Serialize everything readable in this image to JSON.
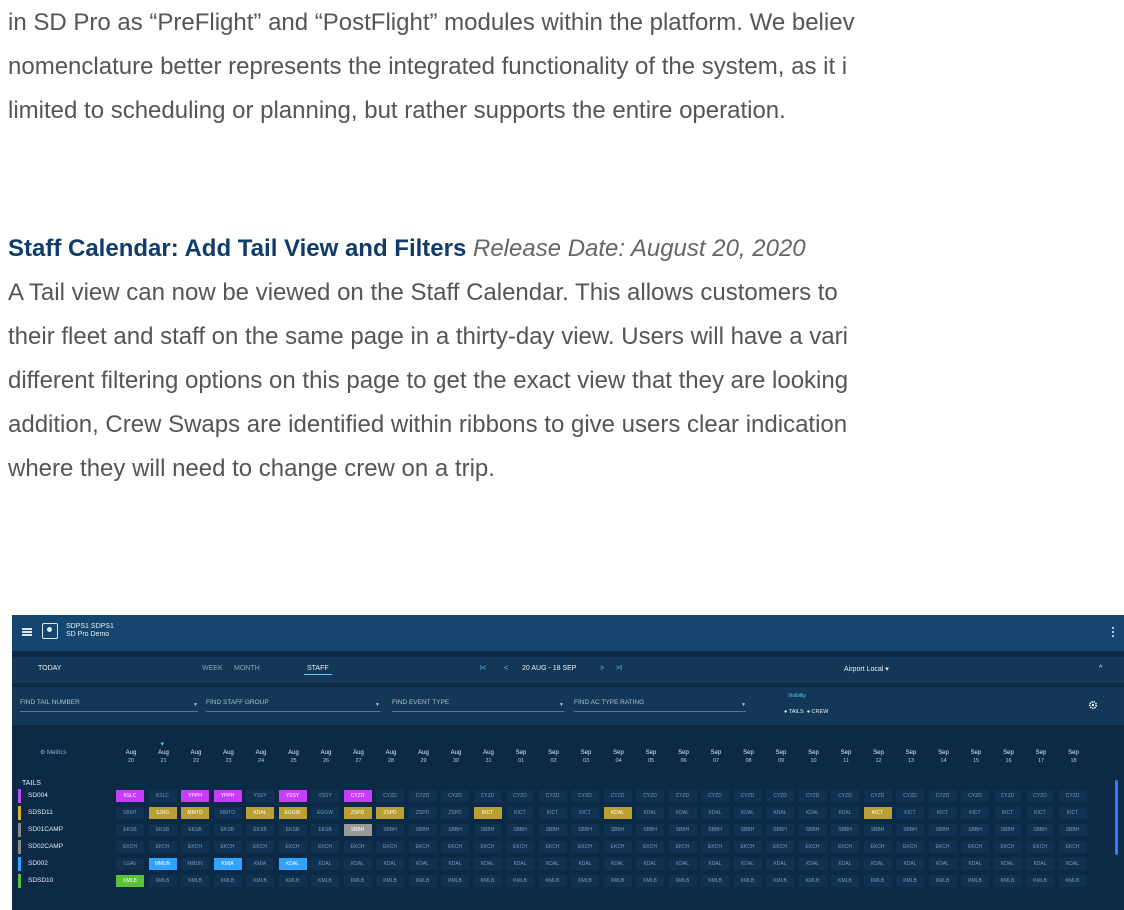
{
  "article": {
    "lines": [
      "in SD Pro as “PreFlight” and “PostFlight” modules within the platform. We believ",
      "nomenclature better represents the integrated functionality of the system, as it i",
      "limited to scheduling or planning, but rather supports the entire operation."
    ],
    "heading_title": "Staff Calendar: Add Tail View and Filters",
    "heading_date": "Release Date: August 20, 2020",
    "body": [
      "A Tail view can now be viewed on the Staff Calendar. This allows customers to",
      "their fleet and staff on the same page in a thirty-day view. Users will have a vari",
      "different filtering options on this page to get the exact view that they are looking",
      "addition, Crew Swaps are identified within ribbons to give users clear indication",
      "where they will need to change crew on a trip."
    ]
  },
  "app": {
    "user_line1": "SDPS1 SDPS1",
    "user_line2": "SD Pro Demo",
    "today": "TODAY",
    "week": "WEEK",
    "month": "MONTH",
    "staff": "STAFF",
    "first_icon": "first-page-icon",
    "prev_icon": "chevron-left-icon",
    "range": "20 AUG - 18 SEP",
    "next_icon": "chevron-right-icon",
    "last_icon": "last-page-icon",
    "airport": "Airport Local ▾",
    "filters": [
      "FIND TAIL NUMBER",
      "FIND STAFF GROUP",
      "FIND EVENT TYPE",
      "FIND AC TYPE RATING"
    ],
    "visibility": "Visibility",
    "vis_tails": "● TAILS",
    "vis_crew": "● CREW",
    "metrics": "Metrics",
    "tails_label": "TAILS",
    "dates": [
      [
        "Aug",
        "20"
      ],
      [
        "Aug",
        "21"
      ],
      [
        "Aug",
        "22"
      ],
      [
        "Aug",
        "23"
      ],
      [
        "Aug",
        "24"
      ],
      [
        "Aug",
        "25"
      ],
      [
        "Aug",
        "26"
      ],
      [
        "Aug",
        "27"
      ],
      [
        "Aug",
        "28"
      ],
      [
        "Aug",
        "29"
      ],
      [
        "Aug",
        "30"
      ],
      [
        "Aug",
        "31"
      ],
      [
        "Sep",
        "01"
      ],
      [
        "Sep",
        "02"
      ],
      [
        "Sep",
        "03"
      ],
      [
        "Sep",
        "04"
      ],
      [
        "Sep",
        "05"
      ],
      [
        "Sep",
        "06"
      ],
      [
        "Sep",
        "07"
      ],
      [
        "Sep",
        "08"
      ],
      [
        "Sep",
        "09"
      ],
      [
        "Sep",
        "10"
      ],
      [
        "Sep",
        "11"
      ],
      [
        "Sep",
        "12"
      ],
      [
        "Sep",
        "13"
      ],
      [
        "Sep",
        "14"
      ],
      [
        "Sep",
        "15"
      ],
      [
        "Sep",
        "16"
      ],
      [
        "Sep",
        "17"
      ],
      [
        "Sep",
        "18"
      ]
    ],
    "today_index": 1,
    "rows": [
      {
        "name": "SD004",
        "tag": "#b84cff",
        "cells": [
          "KSLC",
          "KSLC",
          "YPPH",
          "YPPH",
          "YSSY",
          "YSSY",
          "YSSY",
          "CYZD",
          "CYZD",
          "CYZD",
          "CYZD",
          "CYZD",
          "CYZD",
          "CYZD",
          "CYZD",
          "CYZD",
          "CYZD",
          "CYZD",
          "CYZD",
          "CYZD",
          "CYZD",
          "CYZD",
          "CYZD",
          "CYZD",
          "CYZD",
          "CYZD",
          "CYZD",
          "CYZD",
          "CYZD",
          "CYZD"
        ],
        "hl": {
          "0": "#c83cff",
          "2": "#c83cff",
          "3": "#c83cff",
          "5": "#c83cff",
          "7": "#c83cff"
        }
      },
      {
        "name": "SDSD11",
        "tag": "#d6b52e",
        "cells": [
          "SBMT",
          "SJRG",
          "MMTO",
          "MMTO",
          "KDAL",
          "EGGW",
          "EGGW",
          "ZSPD",
          "ZSPD",
          "ZSPD",
          "ZSPD",
          "KICT",
          "KICT",
          "KICT",
          "KICT",
          "KDAL",
          "KDAL",
          "KDAL",
          "KDAL",
          "KDAL",
          "KDAL",
          "KDAL",
          "KDAL",
          "KICT",
          "KICT",
          "KICT",
          "KICT",
          "KICT",
          "KICT",
          "KICT"
        ],
        "hl": {
          "1": "#b8a032",
          "2": "#b8a032",
          "4": "#b8a032",
          "5": "#b8a032",
          "7": "#b8a032",
          "8": "#b8a032",
          "11": "#b8a032",
          "15": "#b8a032",
          "23": "#b8a032"
        }
      },
      {
        "name": "SD01CAMP",
        "tag": "#8a8a8a",
        "cells": [
          "EKSB",
          "EKSB",
          "EKSB",
          "EKSB",
          "EKSB",
          "EKSB",
          "EKSB",
          "SBBH",
          "SBBH",
          "SBBH",
          "SBBH",
          "SBBH",
          "SBBH",
          "SBBH",
          "SBBH",
          "SBBH",
          "SBBH",
          "SBBH",
          "SBBH",
          "SBBH",
          "SBBH",
          "SBBH",
          "SBBH",
          "SBBH",
          "SBBH",
          "SBBH",
          "SBBH",
          "SBBH",
          "SBBH",
          "SBBH"
        ],
        "hl": {
          "7": "#9a9a9a"
        }
      },
      {
        "name": "SD02CAMP",
        "tag": "#8a8a8a",
        "cells": [
          "EKCH",
          "EKCH",
          "EKCH",
          "EKCH",
          "EKCH",
          "EKCH",
          "EKCH",
          "EKCH",
          "EKCH",
          "EKCH",
          "EKCH",
          "EKCH",
          "EKCH",
          "EKCH",
          "EKCH",
          "EKCH",
          "EKCH",
          "EKCH",
          "EKCH",
          "EKCH",
          "EKCH",
          "EKCH",
          "EKCH",
          "EKCH",
          "EKCH",
          "EKCH",
          "EKCH",
          "EKCH",
          "EKCH",
          "EKCH"
        ],
        "hl": {}
      },
      {
        "name": "SD002",
        "tag": "#2fa3ff",
        "cells": [
          "LGAV",
          "MMUN",
          "MMUN",
          "KMIA",
          "KMIA",
          "KDAL",
          "KDAL",
          "KDAL",
          "KDAL",
          "KDAL",
          "KDAL",
          "KDAL",
          "KDAL",
          "KDAL",
          "KDAL",
          "KDAL",
          "KDAL",
          "KDAL",
          "KDAL",
          "KDAL",
          "KDAL",
          "KDAL",
          "KDAL",
          "KDAL",
          "KDAL",
          "KDAL",
          "KDAL",
          "KDAL",
          "KDAL",
          "KDAL"
        ],
        "hl": {
          "1": "#2fa3ff",
          "3": "#2fa3ff",
          "5": "#2fa3ff"
        }
      },
      {
        "name": "SDSD10",
        "tag": "#59c23a",
        "cells": [
          "KMLB",
          "KMLB",
          "KMLB",
          "KMLB",
          "KMLB",
          "KMLB",
          "KMLB",
          "KMLB",
          "KMLB",
          "KMLB",
          "KMLB",
          "KMLB",
          "KMLB",
          "KMLB",
          "KMLB",
          "KMLB",
          "KMLB",
          "KMLB",
          "KMLB",
          "KMLB",
          "KMLB",
          "KMLB",
          "KMLB",
          "KMLB",
          "KMLB",
          "KMLB",
          "KMLB",
          "KMLB",
          "KMLB",
          "KMLB"
        ],
        "hl": {
          "0": "#59c23a"
        }
      }
    ]
  }
}
